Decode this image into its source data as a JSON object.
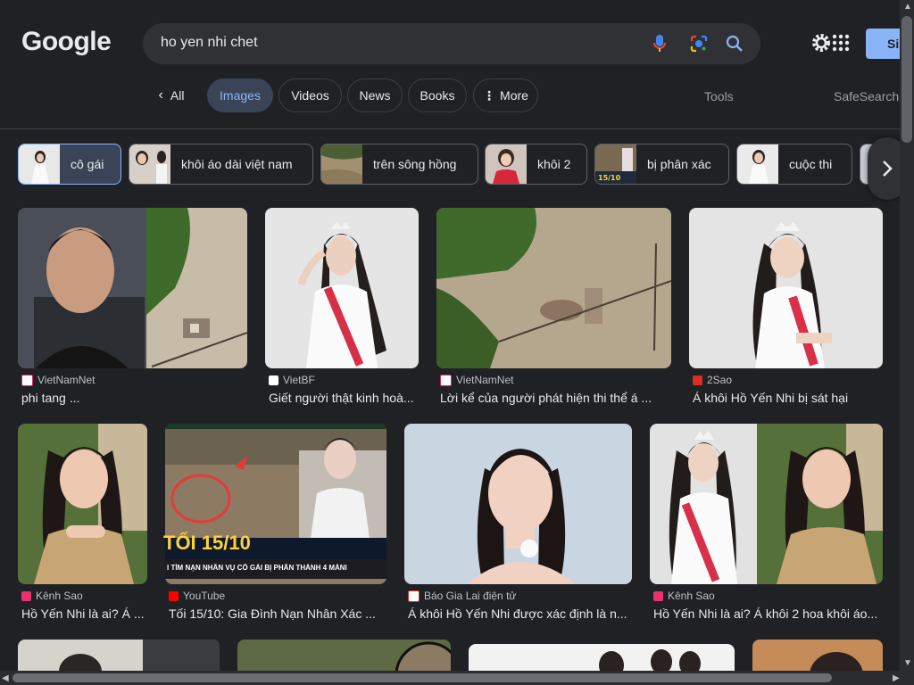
{
  "search": {
    "query": "ho yen nhi chet"
  },
  "header": {
    "logo": "Google",
    "signin_label": "Si"
  },
  "tabs": [
    {
      "label": "All",
      "icon": "chevron-left-icon"
    },
    {
      "label": "Images",
      "active": true
    },
    {
      "label": "Videos"
    },
    {
      "label": "News"
    },
    {
      "label": "Books"
    },
    {
      "label": "More",
      "icon": "more-vert-icon"
    }
  ],
  "tools_label": "Tools",
  "safesearch_label": "SafeSearch",
  "chips": [
    {
      "label": "cô gái",
      "active": true
    },
    {
      "label": "khôi áo dài việt nam"
    },
    {
      "label": "trên sông hồng"
    },
    {
      "label": "khôi 2"
    },
    {
      "label": "bị phân xác"
    },
    {
      "label": "cuộc thi"
    }
  ],
  "results": [
    {
      "source": "VietNamNet",
      "title": "phi tang ..."
    },
    {
      "source": "VietBF",
      "title": "Giết người thật kinh hoà..."
    },
    {
      "source": "VietNamNet",
      "title": "Lời kể của người phát hiện thi thể á ..."
    },
    {
      "source": "2Sao",
      "title": "Á khôi Hồ Yến Nhi bị sát hại"
    },
    {
      "source": "Kênh Sao",
      "title": "Hồ Yến Nhi là ai? Á ..."
    },
    {
      "source": "YouTube",
      "title": "Tối 15/10: Gia Đình Nạn Nhân Xác ..."
    },
    {
      "source": "Báo Gia Lai điện tử",
      "title": "Á khôi Hồ Yến Nhi được xác định là n..."
    },
    {
      "source": "Kênh Sao",
      "title": "Hồ Yến Nhi là ai? Á khôi 2 hoa khôi áo..."
    }
  ],
  "image_overlay": {
    "date_text": "TỐI 15/10",
    "caption_text": "I TÌM NẠN NHÂN VỤ CÔ GÁI BỊ PHÂN THÀNH 4 MẢNI"
  },
  "colors": {
    "accent": "#8ab4f8",
    "background": "#202124",
    "surface": "#303134"
  }
}
